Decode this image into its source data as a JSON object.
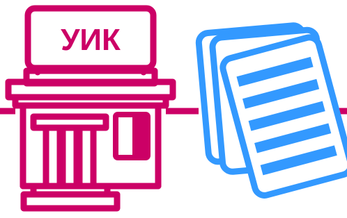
{
  "sign": {
    "label": "УИК"
  },
  "colors": {
    "building": "#cc0066",
    "documents": "#3399ff",
    "background": "#ffffff"
  },
  "icons": {
    "building": "polling-station-icon",
    "documents": "documents-stack-icon",
    "divider": "horizontal-divider-line"
  }
}
